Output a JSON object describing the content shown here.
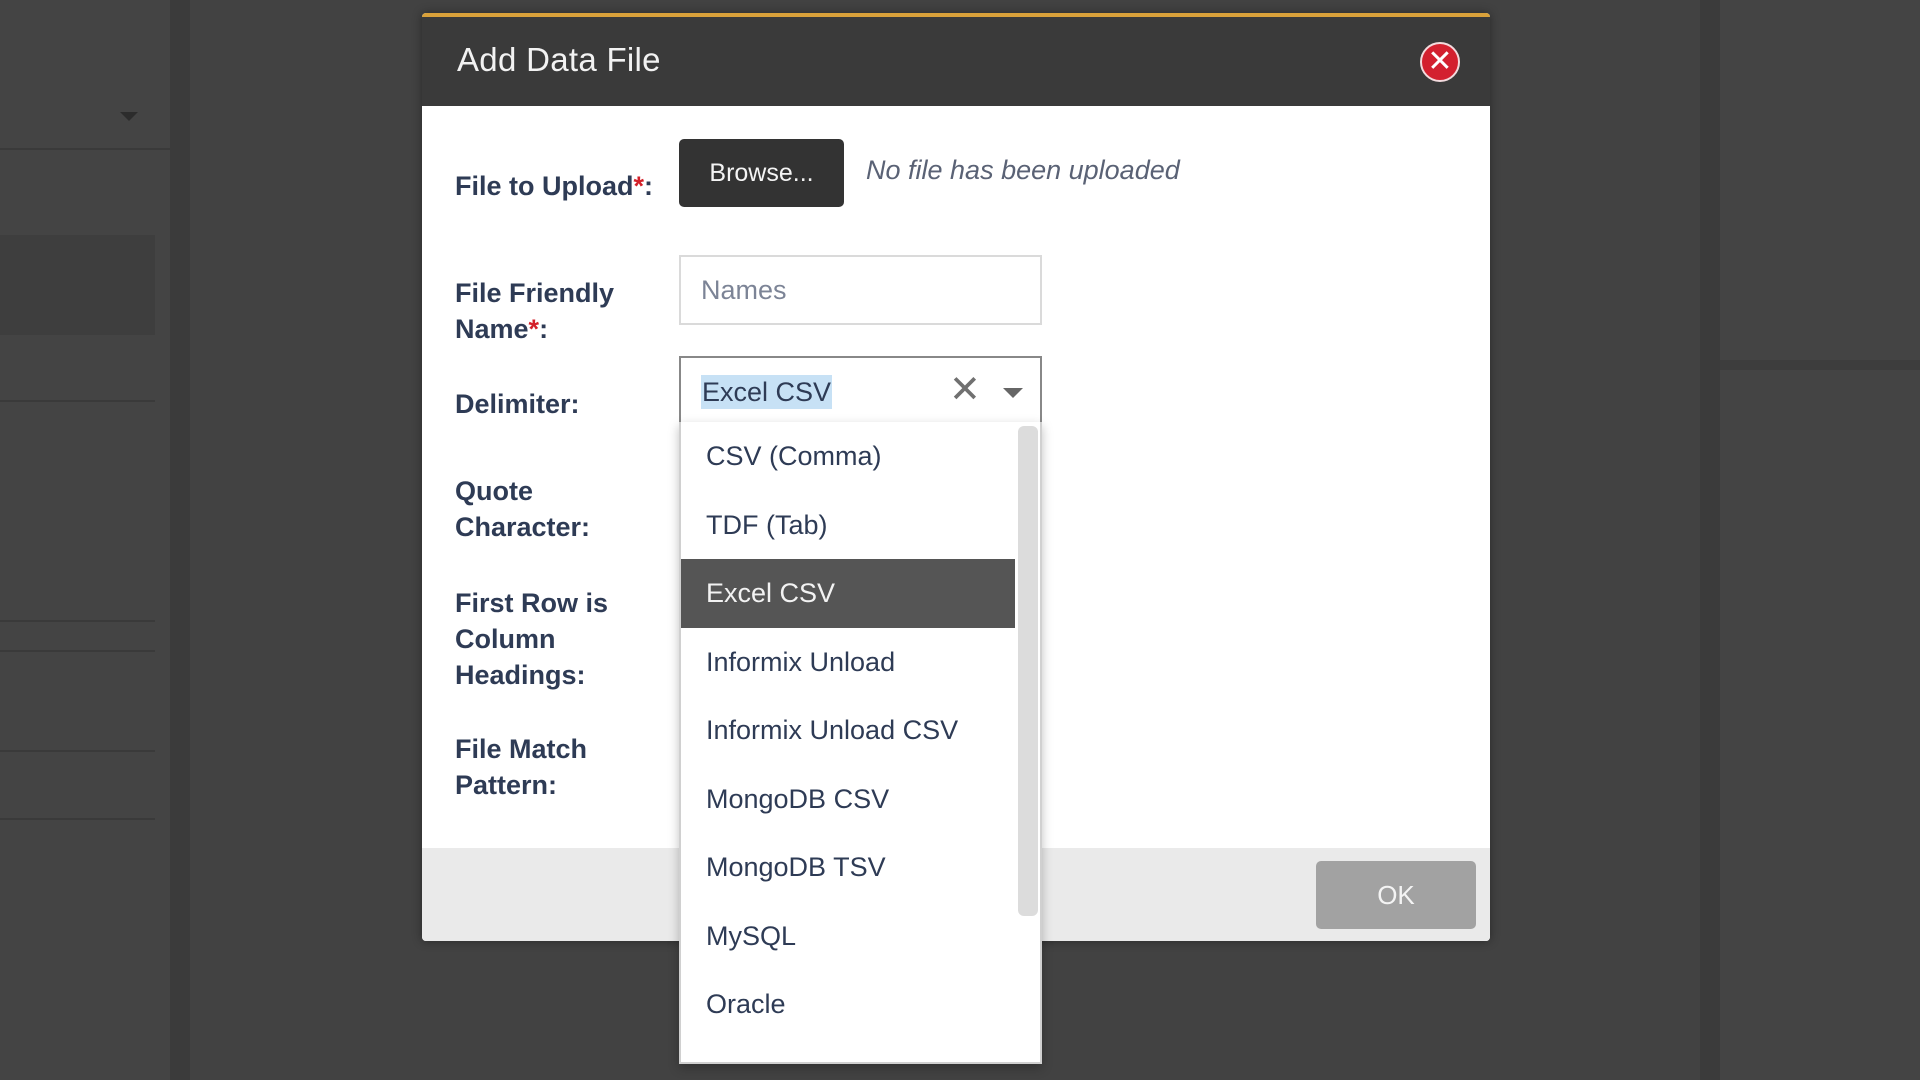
{
  "modal": {
    "title": "Add Data File",
    "close_icon": "close-icon",
    "close_glyph": "✕"
  },
  "form": {
    "file_upload": {
      "label": "File to Upload",
      "required_mark": "*",
      "suffix": ":",
      "browse_label": "Browse...",
      "status": "No file has been uploaded"
    },
    "friendly_name": {
      "label_line1": "File Friendly",
      "label_line2": "Name",
      "required_mark": "*",
      "suffix": ":",
      "placeholder": "Names"
    },
    "delimiter": {
      "label": "Delimiter:",
      "value": "Excel CSV",
      "clear_glyph": "✕"
    },
    "quote_character": {
      "label_line1": "Quote",
      "label_line2": "Character:"
    },
    "first_row_headings": {
      "label_line1": "First Row is",
      "label_line2": "Column",
      "label_line3": "Headings:"
    },
    "file_match_pattern": {
      "label_line1": "File Match",
      "label_line2": "Pattern:"
    }
  },
  "dropdown": {
    "options": [
      "CSV (Comma)",
      "TDF (Tab)",
      "Excel CSV",
      "Informix Unload",
      "Informix Unload CSV",
      "MongoDB CSV",
      "MongoDB TSV",
      "MySQL",
      "Oracle"
    ],
    "selected": "Excel CSV"
  },
  "footer": {
    "ok_label": "OK"
  },
  "colors": {
    "header_bg": "#3a3a3a",
    "header_accent": "#d9a13a",
    "label_text": "#2e3b55",
    "required": "#d32029",
    "close_button": "#d3202f",
    "selected_option_bg": "#555555",
    "ok_button_disabled": "#a2a2a2"
  }
}
